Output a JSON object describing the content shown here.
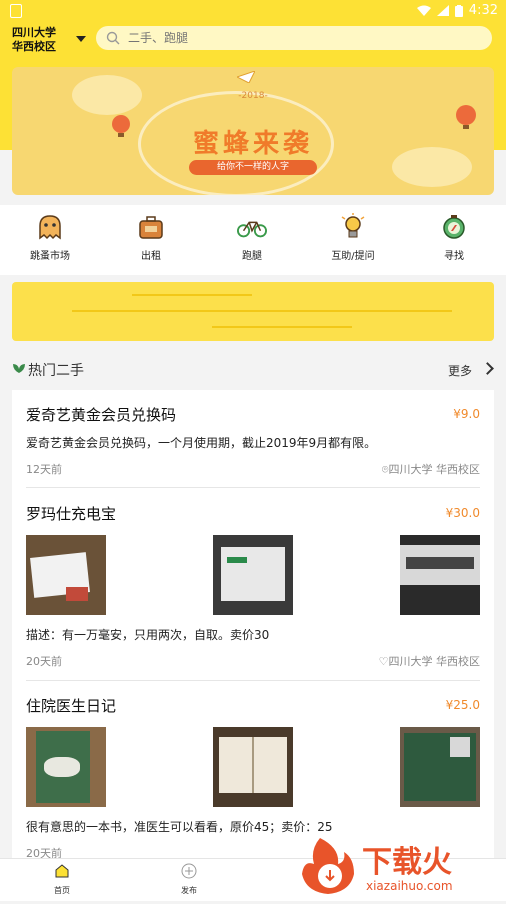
{
  "status_bar": {
    "time": "4:32"
  },
  "header": {
    "campus_line1": "四川大学",
    "campus_line2": "华西校区",
    "search_placeholder": "二手、跑腿"
  },
  "banner": {
    "year": "-2018-",
    "title": "蜜蜂来袭",
    "subtitle": "给你不一样的人字"
  },
  "categories": [
    {
      "label": "跳蚤市场",
      "icon": "ghost-icon"
    },
    {
      "label": "出租",
      "icon": "suitcase-icon"
    },
    {
      "label": "跑腿",
      "icon": "bicycle-icon"
    },
    {
      "label": "互助/提问",
      "icon": "lightbulb-icon"
    },
    {
      "label": "寻找",
      "icon": "compass-icon"
    }
  ],
  "section": {
    "title": "热门二手",
    "more": "更多"
  },
  "items": [
    {
      "title": "爱奇艺黄金会员兑换码",
      "price": "¥9.0",
      "desc": "爱奇艺黄金会员兑换码，一个月使用期，截止2019年9月都有限。",
      "time": "12天前",
      "location": "四川大学 华西校区"
    },
    {
      "title": "罗玛仕充电宝",
      "price": "¥30.0",
      "desc": "描述：有一万毫安，只用两次，自取。卖价30",
      "time": "20天前",
      "location": "四川大学 华西校区"
    },
    {
      "title": "住院医生日记",
      "price": "¥25.0",
      "desc": "很有意思的一本书，准医生可以看看，原价45；卖价：25",
      "time": "20天前"
    }
  ],
  "tabbar": {
    "home": "首页",
    "publish": "发布"
  },
  "watermark": {
    "brand": "下载火",
    "url": "xiazaihuo.com"
  },
  "colors": {
    "brand_yellow": "#fde135",
    "price_orange": "#f08a2c"
  }
}
